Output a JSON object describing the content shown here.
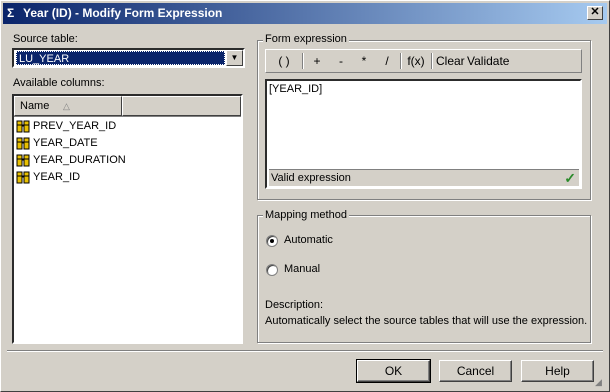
{
  "window": {
    "title": "Year (ID) - Modify Form Expression",
    "icon": "sigma-icon",
    "close_glyph": "✕"
  },
  "left": {
    "source_table_label": "Source table:",
    "source_table_value": "LU_YEAR",
    "available_columns_label": "Available columns:",
    "column_header": "Name",
    "columns": [
      "PREV_YEAR_ID",
      "YEAR_DATE",
      "YEAR_DURATION",
      "YEAR_ID"
    ]
  },
  "form_expression": {
    "group_label": "Form expression",
    "toolbar": {
      "parens": "( )",
      "plus": "+",
      "minus": "-",
      "multiply": "*",
      "divide": "/",
      "function": "f(x)",
      "clear": "Clear",
      "validate": "Validate"
    },
    "text": "[YEAR_ID]",
    "status": "Valid expression",
    "status_icon": "checkmark-icon"
  },
  "mapping": {
    "group_label": "Mapping method",
    "automatic_label": "Automatic",
    "manual_label": "Manual",
    "selected": "Automatic",
    "description_label": "Description:",
    "description_text": "Automatically select the source tables that will use the expression."
  },
  "buttons": {
    "ok": "OK",
    "cancel": "Cancel",
    "help": "Help"
  },
  "colors": {
    "title_bar": "#0a246a",
    "dialog_bg": "#d4d0c8",
    "selection": "#0a246a",
    "check": "#2a8a2a"
  }
}
